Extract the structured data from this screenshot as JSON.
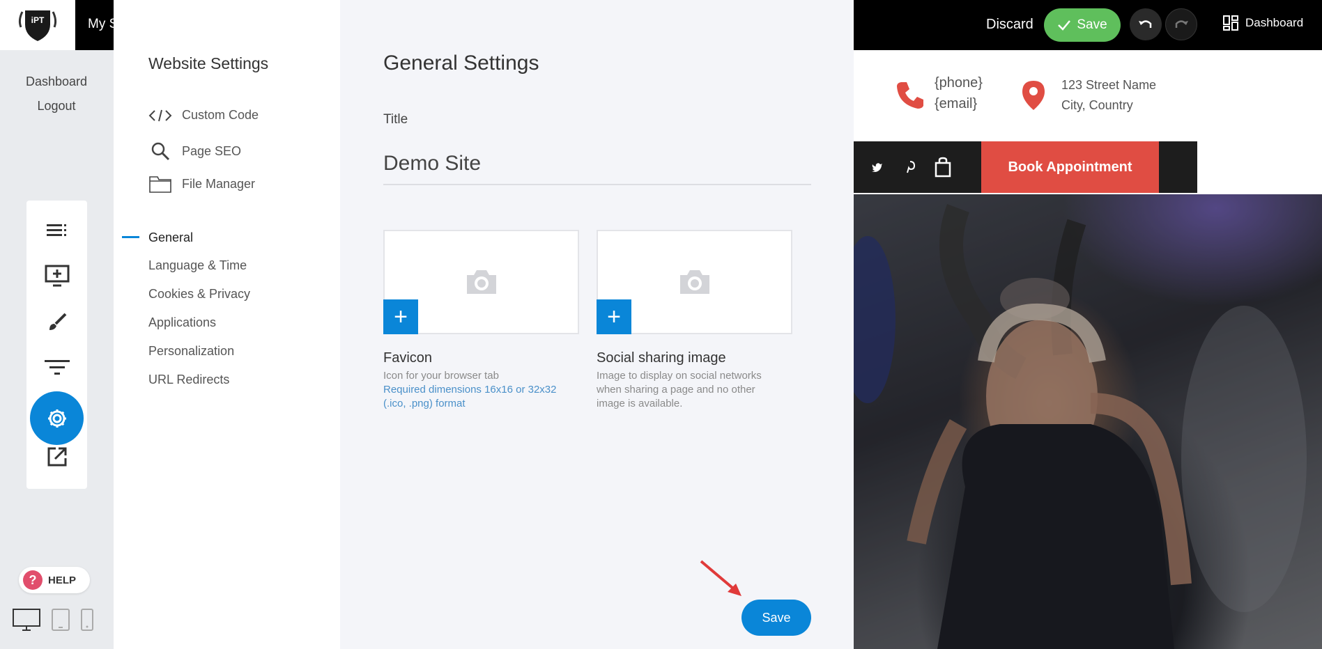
{
  "topbar": {
    "logo_text": "iPT",
    "site_name": "My S",
    "discard_label": "Discard",
    "save_label": "Save",
    "dashboard_label": "Dashboard"
  },
  "left_sidebar": {
    "links": [
      "Dashboard",
      "Logout"
    ],
    "tools": [
      "menu-list-icon",
      "add-section-icon",
      "brush-icon",
      "filter-icon",
      "settings-gear-icon",
      "external-link-icon"
    ],
    "help_label": "HELP"
  },
  "settings_nav": {
    "title": "Website Settings",
    "tools": [
      {
        "label": "Custom Code",
        "icon": "code-icon"
      },
      {
        "label": "Page SEO",
        "icon": "search-icon"
      },
      {
        "label": "File Manager",
        "icon": "folder-icon"
      }
    ],
    "items": [
      "General",
      "Language & Time",
      "Cookies & Privacy",
      "Applications",
      "Personalization",
      "URL Redirects"
    ],
    "active_item": "General"
  },
  "general_settings": {
    "heading": "General Settings",
    "title_label": "Title",
    "title_value": "Demo Site",
    "favicon": {
      "title": "Favicon",
      "desc": "Icon for your browser tab",
      "req_line1": "Required dimensions 16x16 or 32x32",
      "req_line2": "(.ico, .png) format"
    },
    "social": {
      "title": "Social sharing image",
      "desc_line1": "Image to display on social networks",
      "desc_line2": "when sharing a page and no other",
      "desc_line3": "image is available."
    },
    "save_label": "Save"
  },
  "preview": {
    "phone": "{phone}",
    "email": "{email}",
    "address_line1": "123 Street Name",
    "address_line2": "City, Country",
    "book_label": "Book Appointment"
  },
  "colors": {
    "accent_blue": "#0a86d8",
    "save_green": "#5fbf5c",
    "brand_red": "#e04d43",
    "help_pink": "#e14e6c"
  }
}
